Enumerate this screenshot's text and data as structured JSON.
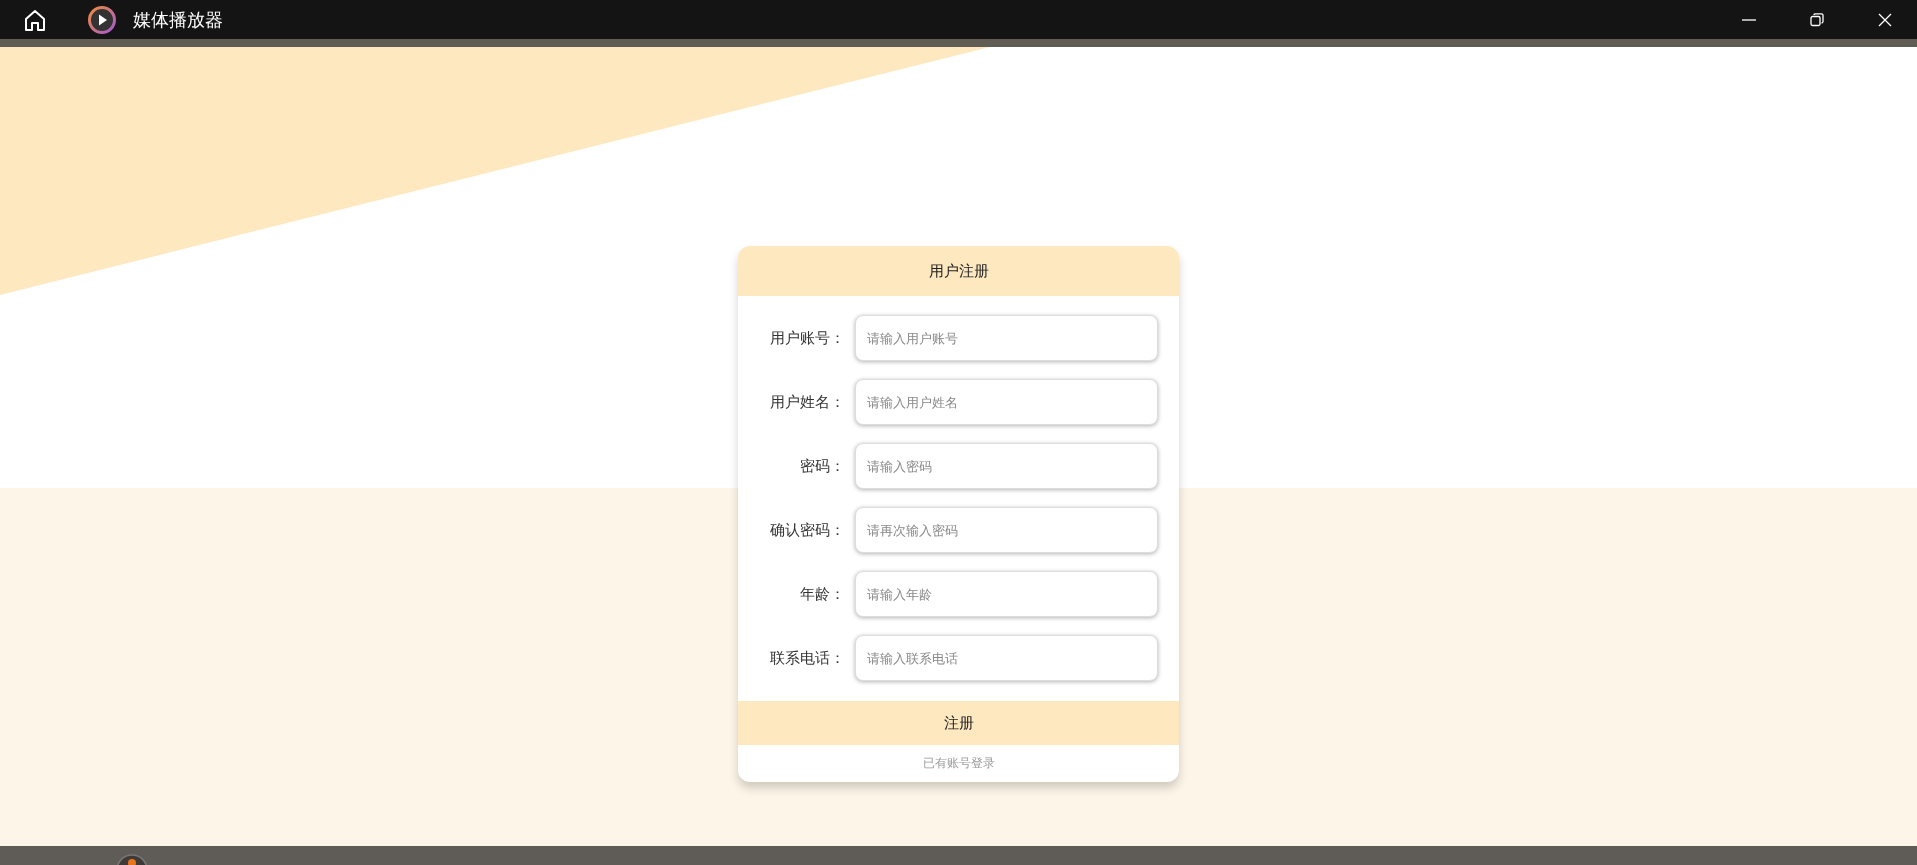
{
  "window": {
    "title": "媒体播放器"
  },
  "form": {
    "title": "用户注册",
    "fields": [
      {
        "label": "用户账号：",
        "placeholder": "请输入用户账号"
      },
      {
        "label": "用户姓名：",
        "placeholder": "请输入用户姓名"
      },
      {
        "label": "密码：",
        "placeholder": "请输入密码"
      },
      {
        "label": "确认密码：",
        "placeholder": "请再次输入密码"
      },
      {
        "label": "年龄：",
        "placeholder": "请输入年龄"
      },
      {
        "label": "联系电话：",
        "placeholder": "请输入联系电话"
      }
    ],
    "submit": "注册",
    "login_link": "已有账号登录"
  }
}
